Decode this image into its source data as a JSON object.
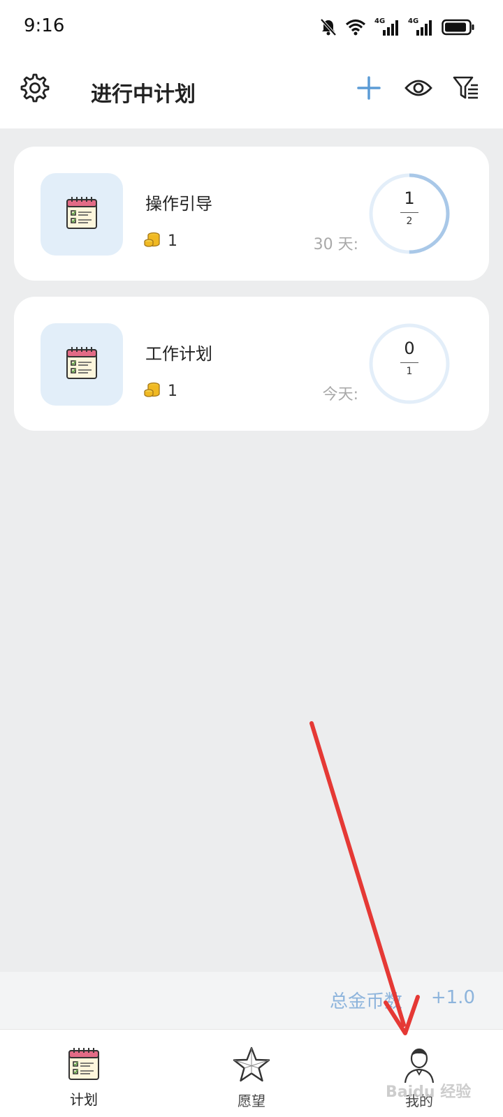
{
  "status_bar": {
    "time": "9:16",
    "icons": [
      "mute-bell-icon",
      "wifi-icon",
      "4g-signal-icon",
      "4g-signal-icon",
      "battery-icon"
    ],
    "network_label_1": "4G",
    "network_label_2": "4G"
  },
  "header": {
    "title": "进行中计划",
    "actions": [
      "gear-icon",
      "plus-icon",
      "eye-icon",
      "filter-icon"
    ],
    "accent_color": "#5b9bd5"
  },
  "plans": [
    {
      "title": "操作引导",
      "coins": "1",
      "days_label": "30 天:",
      "progress_done": "1",
      "progress_total": "2",
      "progress_fraction": 0.5
    },
    {
      "title": "工作计划",
      "coins": "1",
      "days_label": "今天:",
      "progress_done": "0",
      "progress_total": "1",
      "progress_fraction": 0
    }
  ],
  "coins_summary": {
    "label": "总金币数",
    "value": "+1.0",
    "color": "#8db4dc"
  },
  "bottom_nav": {
    "items": [
      {
        "label": "计划",
        "icon": "calendar-checklist-icon",
        "active": true
      },
      {
        "label": "愿望",
        "icon": "star-icon",
        "active": false
      },
      {
        "label": "我的",
        "icon": "user-avatar-icon",
        "active": false
      }
    ]
  },
  "watermark": "Baidu 经验"
}
